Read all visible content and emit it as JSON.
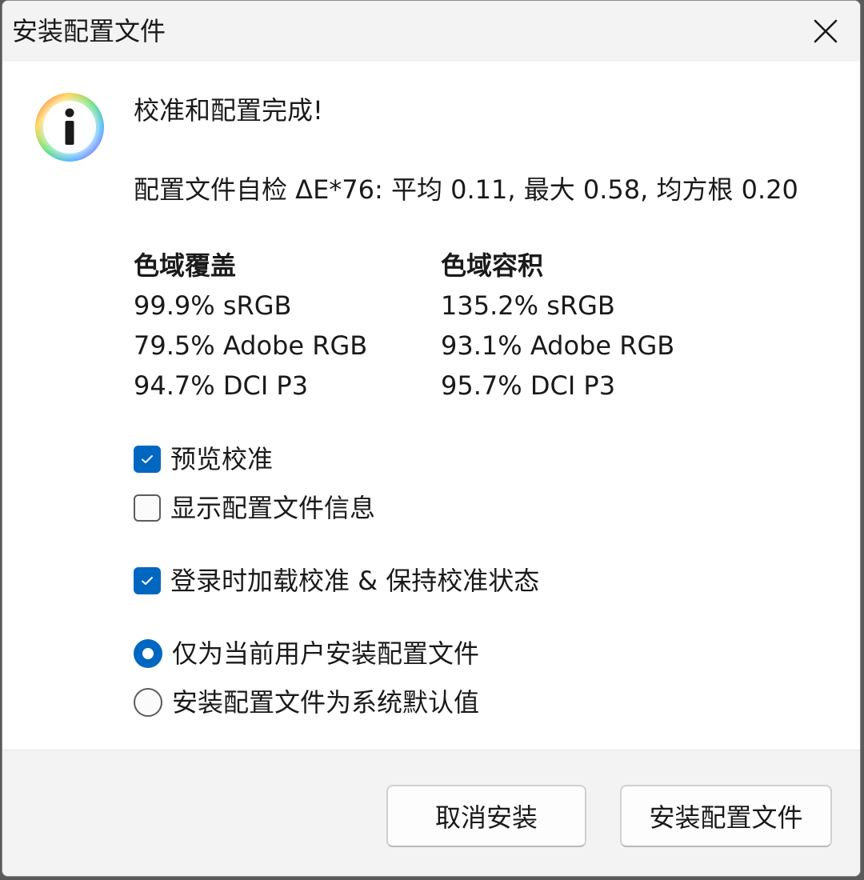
{
  "window": {
    "title": "安装配置文件",
    "close_icon": "close-icon"
  },
  "message": {
    "icon": "info-icon",
    "heading": "校准和配置完成!",
    "self_check": "配置文件自检 ΔE*76: 平均 0.11, 最大 0.58, 均方根 0.20"
  },
  "gamut": {
    "coverage": {
      "title": "色域覆盖",
      "items": [
        "99.9% sRGB",
        "79.5% Adobe RGB",
        "94.7% DCI P3"
      ]
    },
    "volume": {
      "title": "色域容积",
      "items": [
        "135.2% sRGB",
        "93.1% Adobe RGB",
        "95.7% DCI P3"
      ]
    }
  },
  "options": {
    "preview_calibration": {
      "label": "预览校准",
      "checked": true
    },
    "show_profile_info": {
      "label": "显示配置文件信息",
      "checked": false
    },
    "load_on_login": {
      "label": "登录时加载校准 & 保持校准状态",
      "checked": true
    },
    "install_current_user": {
      "label": "仅为当前用户安装配置文件",
      "selected": true
    },
    "install_system_default": {
      "label": "安装配置文件为系统默认值",
      "selected": false
    }
  },
  "buttons": {
    "cancel": "取消安装",
    "install": "安装配置文件"
  },
  "colors": {
    "accent": "#0067c0",
    "titlebar": "#f3f3f3",
    "footer": "#f3f3f3"
  }
}
